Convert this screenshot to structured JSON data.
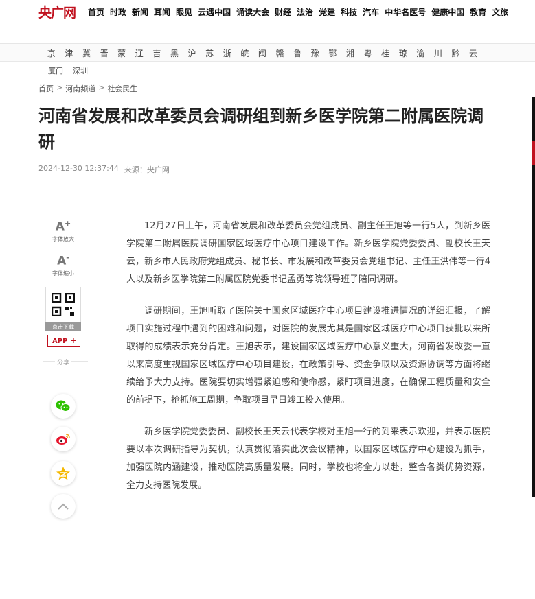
{
  "header": {
    "logo": "央广网",
    "nav": [
      "首页",
      "时政",
      "新闻",
      "耳闻",
      "眼见",
      "云遇中国",
      "诵读大会",
      "财经",
      "法治",
      "党建",
      "科技",
      "汽车",
      "中华名医号",
      "健康中国",
      "教育",
      "文旅"
    ]
  },
  "regions": {
    "provinces": [
      "京",
      "津",
      "冀",
      "晋",
      "蒙",
      "辽",
      "吉",
      "黑",
      "沪",
      "苏",
      "浙",
      "皖",
      "闽",
      "赣",
      "鲁",
      "豫",
      "鄂",
      "湘",
      "粤",
      "桂",
      "琼",
      "渝",
      "川",
      "黔",
      "云"
    ],
    "cities": [
      "厦门",
      "深圳"
    ]
  },
  "breadcrumb": {
    "items": [
      "首页",
      "河南频道",
      "社会民生"
    ],
    "separator": ">"
  },
  "article": {
    "title": "河南省发展和改革委员会调研组到新乡医学院第二附属医院调研",
    "datetime": "2024-12-30 12:37:44",
    "source": "来源：央广网",
    "paragraphs": [
      "12月27日上午，河南省发展和改革委员会党组成员、副主任王旭等一行5人，到新乡医学院第二附属医院调研国家区域医疗中心项目建设工作。新乡医学院党委委员、副校长王天云，新乡市人民政府党组成员、秘书长、市发展和改革委员会党组书记、主任王洪伟等一行4人以及新乡医学院第二附属医院党委书记孟勇等院领导班子陪同调研。",
      "调研期间，王旭听取了医院关于国家区域医疗中心项目建设推进情况的详细汇报，了解项目实施过程中遇到的困难和问题，对医院的发展尤其是国家区域医疗中心项目获批以来所取得的成绩表示充分肯定。王旭表示，建设国家区域医疗中心意义重大，河南省发改委一直以来高度重视国家区域医疗中心项目建设，在政策引导、资金争取以及资源协调等方面将继续给予大力支持。医院要切实增强紧迫感和使命感，紧盯项目进度，在确保工程质量和安全的前提下，抢抓施工周期，争取项目早日竣工投入使用。",
      "新乡医学院党委委员、副校长王天云代表学校对王旭一行的到来表示欢迎，并表示医院要以本次调研指导为契机，认真贯彻落实此次会议精神，以国家区域医疗中心建设为抓手，加强医院内涵建设，推动医院高质量发展。同时，学校也将全力以赴，整合各类优势资源，全力支持医院发展。"
    ]
  },
  "sidebar": {
    "font_increase": "字体放大",
    "font_decrease": "字体缩小",
    "font_increase_glyph": "A",
    "font_decrease_glyph": "A",
    "plus": "+",
    "minus": "-",
    "download": "点击下载",
    "app": "APP",
    "share": "分享"
  },
  "colors": {
    "brand_red": "#c1121f",
    "wechat_green": "#2dc100",
    "weibo_red": "#e6162d",
    "qzone_yellow": "#f5b800"
  }
}
